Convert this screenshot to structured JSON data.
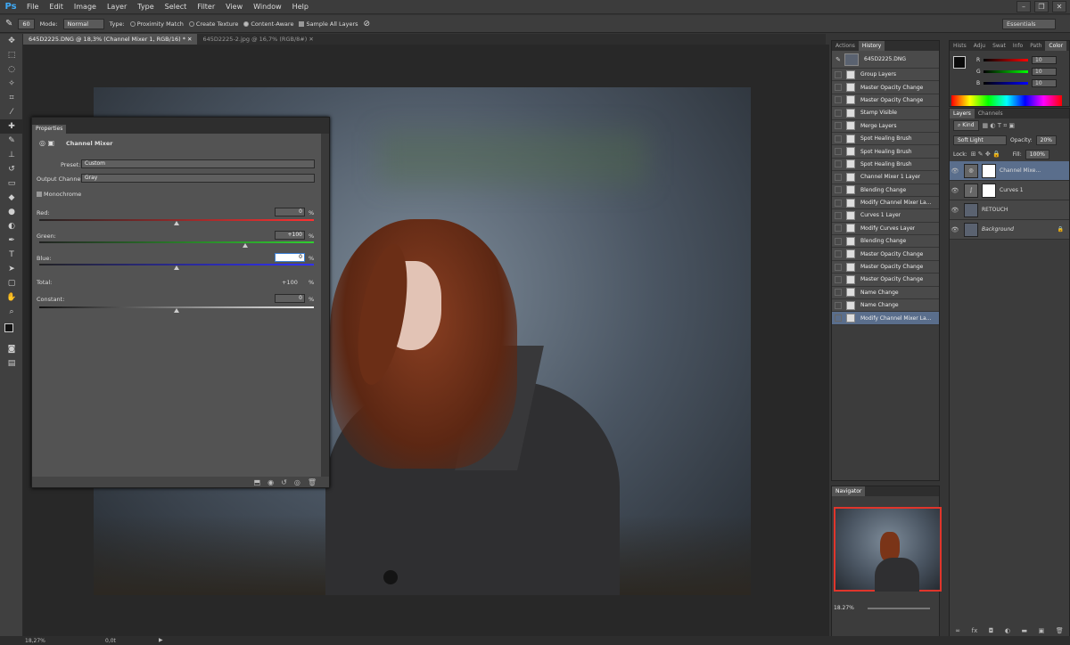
{
  "app": {
    "logo": "Ps"
  },
  "menu": [
    "File",
    "Edit",
    "Image",
    "Layer",
    "Type",
    "Select",
    "Filter",
    "View",
    "Window",
    "Help"
  ],
  "options_bar": {
    "brush_size": "60",
    "mode_label": "Mode:",
    "mode_value": "Normal",
    "type_label": "Type:",
    "type_options": [
      "Proximity Match",
      "Create Texture",
      "Content-Aware"
    ],
    "type_selected": "Content-Aware",
    "sample_all_layers": "Sample All Layers",
    "workspace": "Essentials"
  },
  "doc_tabs": [
    {
      "label": "645D2225.DNG @ 18,3% (Channel Mixer 1, RGB/16) *",
      "active": true
    },
    {
      "label": "645D2225-2.jpg @ 16,7% (RGB/8#)",
      "active": false
    }
  ],
  "properties": {
    "tab": "Properties",
    "adjustment": "Channel Mixer",
    "preset_label": "Preset:",
    "preset_value": "Custom",
    "output_label": "Output Channel:",
    "output_value": "Gray",
    "monochrome": "Monochrome",
    "red_label": "Red:",
    "red_value": "0",
    "red_fraction": 0.5,
    "green_label": "Green:",
    "green_value": "+100",
    "green_fraction": 0.75,
    "blue_label": "Blue:",
    "blue_value": "0",
    "blue_fraction": 0.5,
    "total_label": "Total:",
    "total_value": "+100",
    "constant_label": "Constant:",
    "constant_value": "0",
    "constant_fraction": 0.5,
    "pct": "%"
  },
  "history": {
    "tabs": [
      "Actions",
      "History"
    ],
    "snapshot": "645D2225.DNG",
    "items": [
      "Group Layers",
      "Master Opacity Change",
      "Master Opacity Change",
      "Stamp Visible",
      "Merge Layers",
      "Spot Healing Brush",
      "Spot Healing Brush",
      "Spot Healing Brush",
      "Channel Mixer 1 Layer",
      "Blending Change",
      "Modify Channel Mixer La...",
      "Curves 1 Layer",
      "Modify Curves Layer",
      "Blending Change",
      "Master Opacity Change",
      "Master Opacity Change",
      "Master Opacity Change",
      "Name Change",
      "Name Change",
      "Modify Channel Mixer La..."
    ],
    "selected_index": 19
  },
  "navigator": {
    "tab": "Navigator",
    "zoom": "18.27%"
  },
  "color_panel": {
    "tabs": [
      "Hists",
      "Adju",
      "Swat",
      "Info",
      "Path",
      "Color"
    ],
    "r_label": "R",
    "r_value": "10",
    "g_label": "G",
    "g_value": "10",
    "b_label": "B",
    "b_value": "10"
  },
  "layers": {
    "tabs": [
      "Layers",
      "Channels"
    ],
    "kind": "Kind",
    "blend": "Soft Light",
    "opacity_label": "Opacity:",
    "opacity_value": "20%",
    "lock_label": "Lock:",
    "fill_label": "Fill:",
    "fill_value": "100%",
    "items": [
      {
        "name": "Channel Mixe...",
        "selected": true
      },
      {
        "name": "Curves 1",
        "selected": false
      },
      {
        "name": "RETOUCH",
        "selected": false
      },
      {
        "name": "Background",
        "selected": false
      }
    ]
  },
  "status": {
    "zoom": "18,27%",
    "info": "0,0t"
  }
}
